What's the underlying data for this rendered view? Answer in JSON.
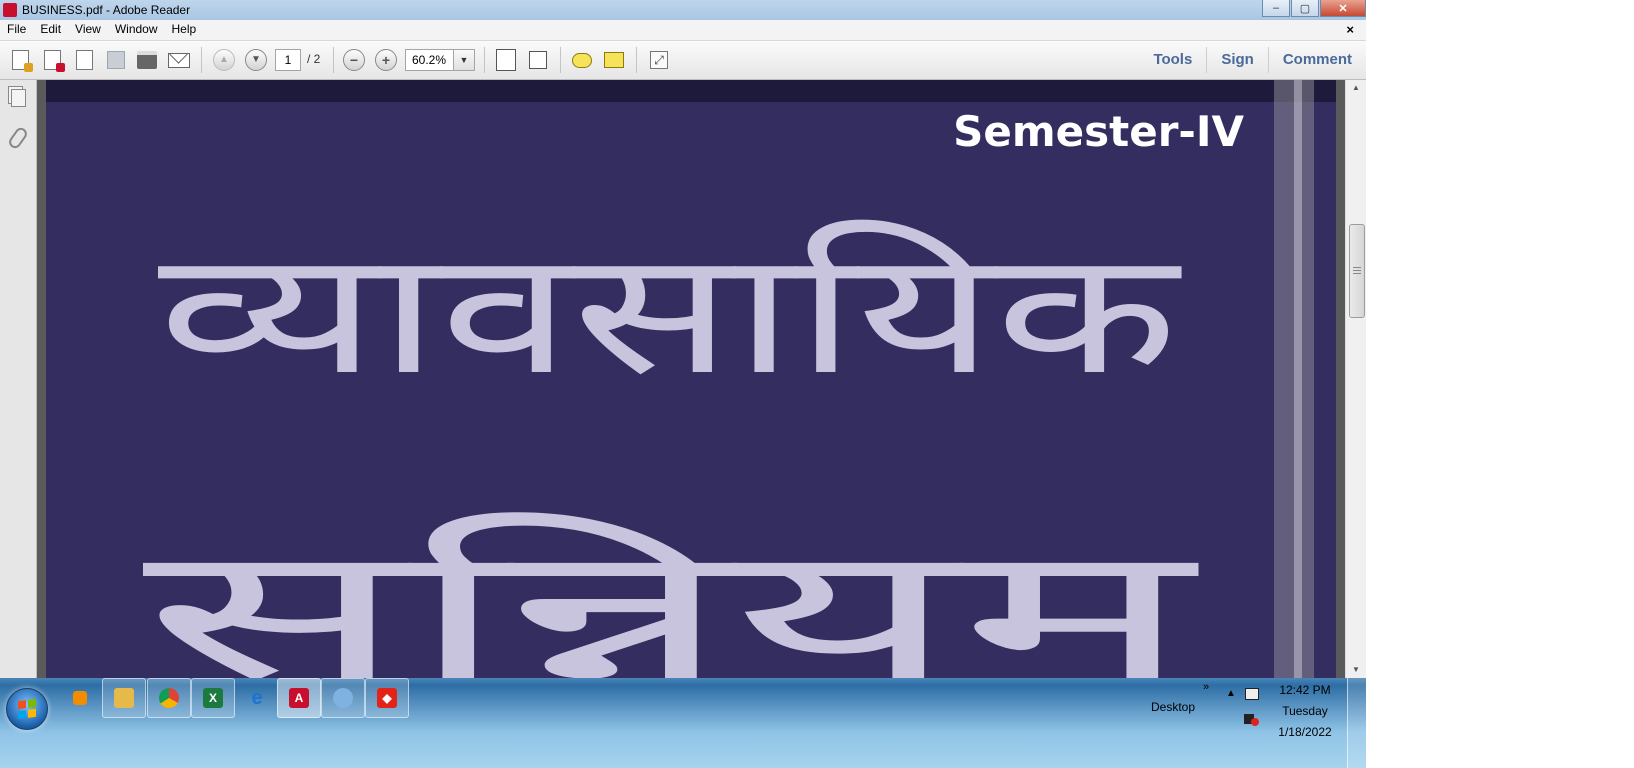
{
  "window": {
    "title": "BUSINESS.pdf - Adobe Reader",
    "controls": {
      "minimize": "–",
      "maximize": "▢",
      "close": "✕"
    }
  },
  "menubar": {
    "items": [
      "File",
      "Edit",
      "View",
      "Window",
      "Help"
    ],
    "close_doc": "×"
  },
  "toolbar": {
    "page_current": "1",
    "page_total": "/ 2",
    "zoom": "60.2%",
    "zoom_dropdown": "▼",
    "zoom_out": "−",
    "zoom_in": "+",
    "prev_page": "▲",
    "next_page": "▼",
    "expand": "⤢",
    "panel_links": [
      "Tools",
      "Sign",
      "Comment"
    ]
  },
  "document": {
    "semester": "Semester-IV",
    "title_line1": "व्यावसायिक",
    "title_line2": "सन्नियम",
    "colors": {
      "cover_bg": "#332e5f",
      "title_fill": "#c9c4dd",
      "semester_fill": "#ffffff"
    }
  },
  "scrollbar": {
    "up": "▲",
    "down": "▼",
    "position": 0.27
  },
  "taskbar": {
    "apps": [
      "media-player",
      "windows-explorer",
      "google-chrome",
      "microsoft-excel",
      "internet-explorer",
      "adobe-reader",
      "paint",
      "anydesk"
    ],
    "tray": {
      "desktop_label": "Desktop",
      "overflow": "»",
      "show_hidden": "▲",
      "time": "12:42 PM",
      "day": "Tuesday",
      "date": "1/18/2022"
    }
  }
}
